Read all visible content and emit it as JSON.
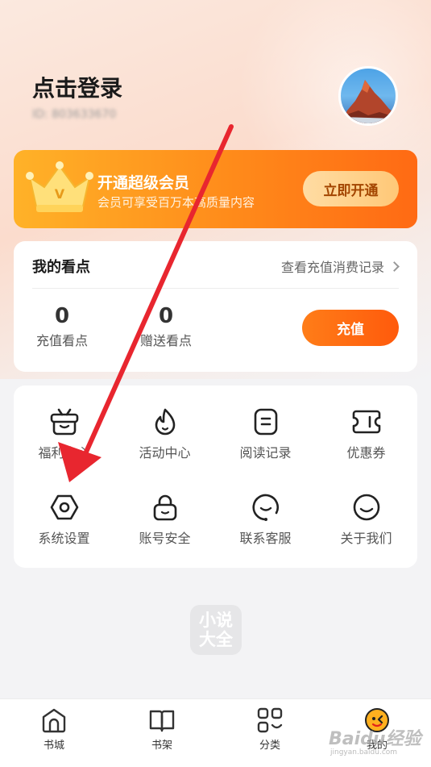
{
  "profile": {
    "login_prompt": "点击登录",
    "user_id": "ID: 803633670"
  },
  "vip": {
    "title": "开通超级会员",
    "subtitle": "会员可享受百万本高质量内容",
    "button": "立即开通"
  },
  "points": {
    "title": "我的看点",
    "history_link": "查看充值消费记录",
    "recharge_points": "0",
    "recharge_points_label": "充值看点",
    "gift_points": "0",
    "gift_points_label": "赠送看点",
    "recharge_button": "充值"
  },
  "menu": {
    "items": [
      {
        "label": "福利中心",
        "icon": "gift-box-icon"
      },
      {
        "label": "活动中心",
        "icon": "flame-icon"
      },
      {
        "label": "阅读记录",
        "icon": "document-icon"
      },
      {
        "label": "优惠券",
        "icon": "coupon-icon"
      },
      {
        "label": "系统设置",
        "icon": "settings-icon"
      },
      {
        "label": "账号安全",
        "icon": "lock-icon"
      },
      {
        "label": "联系客服",
        "icon": "customer-service-icon"
      },
      {
        "label": "关于我们",
        "icon": "smile-icon"
      }
    ]
  },
  "watermark": {
    "line1": "小说",
    "line2": "大全"
  },
  "tabbar": {
    "tabs": [
      {
        "label": "书城",
        "icon": "bookstore-icon"
      },
      {
        "label": "书架",
        "icon": "bookshelf-icon"
      },
      {
        "label": "分类",
        "icon": "category-icon"
      },
      {
        "label": "我的",
        "icon": "profile-icon",
        "active": true
      }
    ]
  },
  "overlay": {
    "baidu_text": "Baidu经验",
    "baidu_url": "jingyan.baidu.com"
  },
  "colors": {
    "accent": "#ff6a14",
    "vip_gradient_start": "#ffb228",
    "arrow": "#e8262f"
  }
}
